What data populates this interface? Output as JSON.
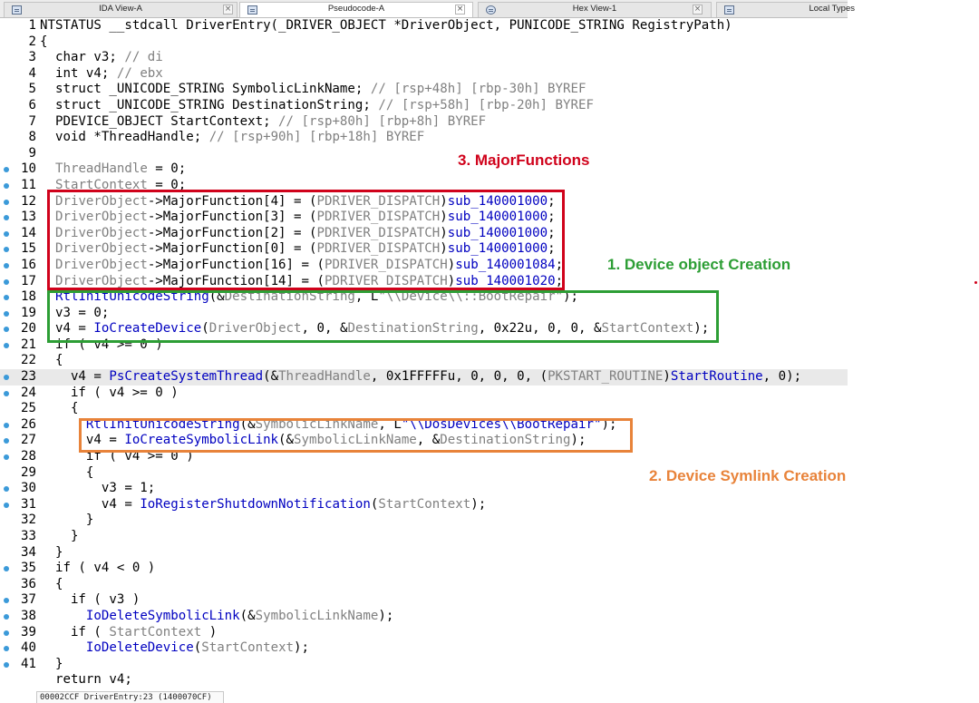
{
  "tabs": [
    {
      "label": "IDA View-A",
      "icon": "disassembly-icon",
      "active": false
    },
    {
      "label": "Pseudocode-A",
      "icon": "pseudocode-icon",
      "active": true
    },
    {
      "label": "Hex View-1",
      "icon": "hex-view-icon",
      "active": false
    },
    {
      "label": "Local Types",
      "icon": "local-types-icon",
      "active": false
    }
  ],
  "close_glyph": "×",
  "code": {
    "lines": [
      {
        "n": "1",
        "dot": false,
        "hl": false,
        "parts": [
          [
            "n",
            "NTSTATUS __stdcall DriverEntry(_DRIVER_OBJECT *DriverObject, PUNICODE_STRING RegistryPath)"
          ]
        ]
      },
      {
        "n": "2",
        "dot": false,
        "hl": false,
        "parts": [
          [
            "n",
            "{"
          ]
        ]
      },
      {
        "n": "3",
        "dot": false,
        "hl": false,
        "parts": [
          [
            "n",
            "  char v3; "
          ],
          [
            "g",
            "// di"
          ]
        ]
      },
      {
        "n": "4",
        "dot": false,
        "hl": false,
        "parts": [
          [
            "n",
            "  int v4; "
          ],
          [
            "g",
            "// ebx"
          ]
        ]
      },
      {
        "n": "5",
        "dot": false,
        "hl": false,
        "parts": [
          [
            "n",
            "  struct _UNICODE_STRING SymbolicLinkName; "
          ],
          [
            "g",
            "// [rsp+48h] [rbp-30h] BYREF"
          ]
        ]
      },
      {
        "n": "6",
        "dot": false,
        "hl": false,
        "parts": [
          [
            "n",
            "  struct _UNICODE_STRING DestinationString; "
          ],
          [
            "g",
            "// [rsp+58h] [rbp-20h] BYREF"
          ]
        ]
      },
      {
        "n": "7",
        "dot": false,
        "hl": false,
        "parts": [
          [
            "n",
            "  PDEVICE_OBJECT StartContext; "
          ],
          [
            "g",
            "// [rsp+80h] [rbp+8h] BYREF"
          ]
        ]
      },
      {
        "n": "8",
        "dot": false,
        "hl": false,
        "parts": [
          [
            "n",
            "  void *ThreadHandle; "
          ],
          [
            "g",
            "// [rsp+90h] [rbp+18h] BYREF"
          ]
        ]
      },
      {
        "n": "9",
        "dot": false,
        "hl": false,
        "parts": [
          [
            "n",
            ""
          ]
        ]
      },
      {
        "n": "10",
        "dot": true,
        "hl": false,
        "parts": [
          [
            "n",
            "  "
          ],
          [
            "g",
            "ThreadHandle"
          ],
          [
            "n",
            " = 0;"
          ]
        ]
      },
      {
        "n": "11",
        "dot": true,
        "hl": false,
        "parts": [
          [
            "n",
            "  "
          ],
          [
            "g",
            "StartContext"
          ],
          [
            "n",
            " = 0;"
          ]
        ]
      },
      {
        "n": "12",
        "dot": true,
        "hl": false,
        "parts": [
          [
            "n",
            "  "
          ],
          [
            "g",
            "DriverObject"
          ],
          [
            "n",
            "->MajorFunction[4] = ("
          ],
          [
            "g",
            "PDRIVER_DISPATCH"
          ],
          [
            "n",
            ")"
          ],
          [
            "b",
            "sub_140001000"
          ],
          [
            "n",
            ";"
          ]
        ]
      },
      {
        "n": "13",
        "dot": true,
        "hl": false,
        "parts": [
          [
            "n",
            "  "
          ],
          [
            "g",
            "DriverObject"
          ],
          [
            "n",
            "->MajorFunction[3] = ("
          ],
          [
            "g",
            "PDRIVER_DISPATCH"
          ],
          [
            "n",
            ")"
          ],
          [
            "b",
            "sub_140001000"
          ],
          [
            "n",
            ";"
          ]
        ]
      },
      {
        "n": "14",
        "dot": true,
        "hl": false,
        "parts": [
          [
            "n",
            "  "
          ],
          [
            "g",
            "DriverObject"
          ],
          [
            "n",
            "->MajorFunction[2] = ("
          ],
          [
            "g",
            "PDRIVER_DISPATCH"
          ],
          [
            "n",
            ")"
          ],
          [
            "b",
            "sub_140001000"
          ],
          [
            "n",
            ";"
          ]
        ]
      },
      {
        "n": "15",
        "dot": true,
        "hl": false,
        "parts": [
          [
            "n",
            "  "
          ],
          [
            "g",
            "DriverObject"
          ],
          [
            "n",
            "->MajorFunction[0] = ("
          ],
          [
            "g",
            "PDRIVER_DISPATCH"
          ],
          [
            "n",
            ")"
          ],
          [
            "b",
            "sub_140001000"
          ],
          [
            "n",
            ";"
          ]
        ]
      },
      {
        "n": "16",
        "dot": true,
        "hl": false,
        "parts": [
          [
            "n",
            "  "
          ],
          [
            "g",
            "DriverObject"
          ],
          [
            "n",
            "->MajorFunction[16] = ("
          ],
          [
            "g",
            "PDRIVER_DISPATCH"
          ],
          [
            "n",
            ")"
          ],
          [
            "b",
            "sub_140001084"
          ],
          [
            "n",
            ";"
          ]
        ]
      },
      {
        "n": "17",
        "dot": true,
        "hl": false,
        "parts": [
          [
            "n",
            "  "
          ],
          [
            "g",
            "DriverObject"
          ],
          [
            "n",
            "->MajorFunction[14] = ("
          ],
          [
            "g",
            "PDRIVER_DISPATCH"
          ],
          [
            "n",
            ")"
          ],
          [
            "b",
            "sub_140001020"
          ],
          [
            "n",
            ";"
          ]
        ]
      },
      {
        "n": "18",
        "dot": true,
        "hl": false,
        "parts": [
          [
            "n",
            "  "
          ],
          [
            "b",
            "RtlInitUnicodeString"
          ],
          [
            "n",
            "(&"
          ],
          [
            "g",
            "DestinationString"
          ],
          [
            "n",
            ", L"
          ],
          [
            "g",
            "\"\\\\Device\\\\::BootRepair\""
          ],
          [
            "n",
            ");"
          ]
        ]
      },
      {
        "n": "19",
        "dot": true,
        "hl": false,
        "parts": [
          [
            "n",
            "  v3 = 0;"
          ]
        ]
      },
      {
        "n": "20",
        "dot": true,
        "hl": false,
        "parts": [
          [
            "n",
            "  v4 = "
          ],
          [
            "b",
            "IoCreateDevice"
          ],
          [
            "n",
            "("
          ],
          [
            "g",
            "DriverObject"
          ],
          [
            "n",
            ", 0, &"
          ],
          [
            "g",
            "DestinationString"
          ],
          [
            "n",
            ", 0x22u, 0, 0, &"
          ],
          [
            "g",
            "StartContext"
          ],
          [
            "n",
            ");"
          ]
        ]
      },
      {
        "n": "21",
        "dot": true,
        "hl": false,
        "parts": [
          [
            "n",
            "  if ( v4 >= 0 )"
          ]
        ]
      },
      {
        "n": "22",
        "dot": false,
        "hl": false,
        "parts": [
          [
            "n",
            "  {"
          ]
        ]
      },
      {
        "n": "23",
        "dot": true,
        "hl": true,
        "parts": [
          [
            "n",
            "    v4 = "
          ],
          [
            "b",
            "PsCreateSystemThread"
          ],
          [
            "n",
            "(&"
          ],
          [
            "g",
            "ThreadHandle"
          ],
          [
            "n",
            ", 0x1FFFFFu, 0, 0, 0, ("
          ],
          [
            "g",
            "PKSTART_ROUTINE"
          ],
          [
            "n",
            ")"
          ],
          [
            "b",
            "StartRoutine"
          ],
          [
            "n",
            ", 0);"
          ]
        ]
      },
      {
        "n": "24",
        "dot": true,
        "hl": false,
        "parts": [
          [
            "n",
            "    if ( v4 >= 0 )"
          ]
        ]
      },
      {
        "n": "25",
        "dot": false,
        "hl": false,
        "parts": [
          [
            "n",
            "    {"
          ]
        ]
      },
      {
        "n": "26",
        "dot": true,
        "hl": false,
        "parts": [
          [
            "n",
            "      "
          ],
          [
            "b",
            "RtlInitUnicodeString"
          ],
          [
            "n",
            "(&"
          ],
          [
            "g",
            "SymbolicLinkName"
          ],
          [
            "n",
            ", L"
          ],
          [
            "b",
            "\"\\\\DosDevices\\\\BootRepair\""
          ],
          [
            "n",
            ");"
          ]
        ]
      },
      {
        "n": "27",
        "dot": true,
        "hl": false,
        "parts": [
          [
            "n",
            "      v4 = "
          ],
          [
            "b",
            "IoCreateSymbolicLink"
          ],
          [
            "n",
            "(&"
          ],
          [
            "g",
            "SymbolicLinkName"
          ],
          [
            "n",
            ", &"
          ],
          [
            "g",
            "DestinationString"
          ],
          [
            "n",
            ");"
          ]
        ]
      },
      {
        "n": "28",
        "dot": true,
        "hl": false,
        "parts": [
          [
            "n",
            "      if ( v4 >= 0 )"
          ]
        ]
      },
      {
        "n": "29",
        "dot": false,
        "hl": false,
        "parts": [
          [
            "n",
            "      {"
          ]
        ]
      },
      {
        "n": "30",
        "dot": true,
        "hl": false,
        "parts": [
          [
            "n",
            "        v3 = 1;"
          ]
        ]
      },
      {
        "n": "31",
        "dot": true,
        "hl": false,
        "parts": [
          [
            "n",
            "        v4 = "
          ],
          [
            "b",
            "IoRegisterShutdownNotification"
          ],
          [
            "n",
            "("
          ],
          [
            "g",
            "StartContext"
          ],
          [
            "n",
            ");"
          ]
        ]
      },
      {
        "n": "32",
        "dot": false,
        "hl": false,
        "parts": [
          [
            "n",
            "      }"
          ]
        ]
      },
      {
        "n": "33",
        "dot": false,
        "hl": false,
        "parts": [
          [
            "n",
            "    }"
          ]
        ]
      },
      {
        "n": "34",
        "dot": false,
        "hl": false,
        "parts": [
          [
            "n",
            "  }"
          ]
        ]
      },
      {
        "n": "35",
        "dot": true,
        "hl": false,
        "parts": [
          [
            "n",
            "  if ( v4 < 0 )"
          ]
        ]
      },
      {
        "n": "36",
        "dot": false,
        "hl": false,
        "parts": [
          [
            "n",
            "  {"
          ]
        ]
      },
      {
        "n": "37",
        "dot": true,
        "hl": false,
        "parts": [
          [
            "n",
            "    if ( v3 )"
          ]
        ]
      },
      {
        "n": "38",
        "dot": true,
        "hl": false,
        "parts": [
          [
            "n",
            "      "
          ],
          [
            "b",
            "IoDeleteSymbolicLink"
          ],
          [
            "n",
            "(&"
          ],
          [
            "g",
            "SymbolicLinkName"
          ],
          [
            "n",
            ");"
          ]
        ]
      },
      {
        "n": "39",
        "dot": true,
        "hl": false,
        "parts": [
          [
            "n",
            "    if ( "
          ],
          [
            "g",
            "StartContext"
          ],
          [
            "n",
            " )"
          ]
        ]
      },
      {
        "n": "40",
        "dot": true,
        "hl": false,
        "parts": [
          [
            "n",
            "      "
          ],
          [
            "b",
            "IoDeleteDevice"
          ],
          [
            "n",
            "("
          ],
          [
            "g",
            "StartContext"
          ],
          [
            "n",
            ");"
          ]
        ]
      },
      {
        "n": "41",
        "dot": true,
        "hl": false,
        "parts": [
          [
            "n",
            "  }"
          ]
        ]
      },
      {
        "n": "",
        "dot": false,
        "hl": false,
        "parts": [
          [
            "n",
            "  return v4;"
          ]
        ]
      }
    ]
  },
  "annotations": {
    "major_functions": "3. MajorFunctions",
    "device_object": "1. Device object Creation",
    "device_symlink": "2. Device Symlink Creation"
  },
  "colors": {
    "red": "#d0021b",
    "green": "#2d9e35",
    "orange": "#e8833a",
    "identifier_gray": "#808080",
    "call_blue": "#0000c0",
    "breakpoint_dot": "#3b9ad9"
  },
  "status": {
    "text": "00002CCF DriverEntry:23 (1400070CF)"
  }
}
